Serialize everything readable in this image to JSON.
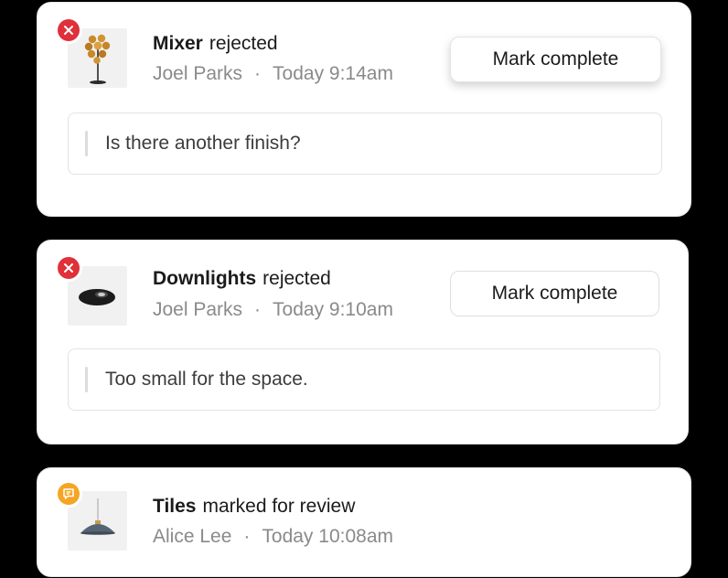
{
  "notifications": [
    {
      "status": "rejected",
      "status_icon": "x-circle-icon",
      "thumbnail_icon": "floor-lamp-icon",
      "item": "Mixer",
      "action": "rejected",
      "user": "Joel Parks",
      "separator": "·",
      "time": "Today 9:14am",
      "button_label": "Mark complete",
      "comment": "Is there another finish?"
    },
    {
      "status": "rejected",
      "status_icon": "x-circle-icon",
      "thumbnail_icon": "downlight-icon",
      "item": "Downlights",
      "action": "rejected",
      "user": "Joel Parks",
      "separator": "·",
      "time": "Today 9:10am",
      "button_label": "Mark complete",
      "comment": "Too small for the space."
    },
    {
      "status": "review",
      "status_icon": "comment-icon",
      "thumbnail_icon": "pendant-lamp-icon",
      "item": "Tiles",
      "action": "marked for review",
      "user": "Alice Lee",
      "separator": "·",
      "time": "Today 10:08am"
    }
  ],
  "colors": {
    "rejected": "#e0303a",
    "review": "#f5a524",
    "text_primary": "#1b1b1b",
    "text_secondary": "#8a8a8a"
  }
}
